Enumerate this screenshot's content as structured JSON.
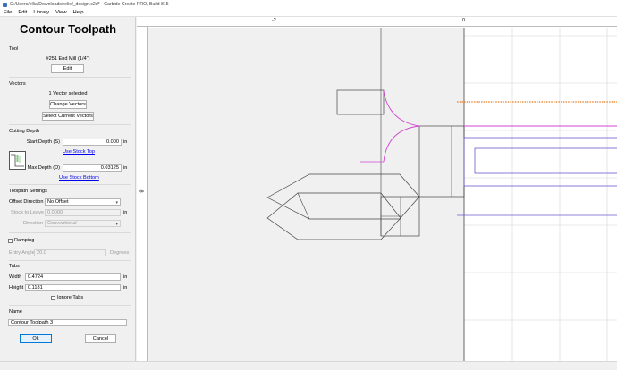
{
  "window": {
    "title": "C:/Users/ellia/Downloads/relief_design.c2d* - Carbide Create PRO, Build 815"
  },
  "menu": [
    "File",
    "Edit",
    "Library",
    "View",
    "Help"
  ],
  "panel": {
    "title": "Contour Toolpath",
    "tool": {
      "heading": "Tool",
      "name": "#251 End Mill (1/4\")",
      "edit_label": "Edit"
    },
    "vectors": {
      "heading": "Vectors",
      "status": "1 Vector selected",
      "change_label": "Change Vectors",
      "select_current_label": "Select Current Vectors"
    },
    "cutting_depth": {
      "heading": "Cutting Depth",
      "start_label": "Start Depth (S)",
      "start_value": "0.000",
      "start_unit": "in",
      "use_stock_top": "Use Stock Top",
      "max_label": "Max Depth (D)",
      "max_value": "0.03125",
      "max_unit": "in",
      "use_stock_bottom": "Use Stock Bottom"
    },
    "settings": {
      "heading": "Toolpath Settings",
      "offset_label": "Offset Direction",
      "offset_value": "No Offset",
      "stock_label": "Stock to Leave",
      "stock_value": "0.0000",
      "stock_unit": "in",
      "direction_label": "Direction",
      "direction_value": "Conventional"
    },
    "ramping": {
      "label": "Ramping",
      "checked": false,
      "angle_label": "Entry Angle",
      "angle_value": "20.0",
      "angle_unit": "Degrees"
    },
    "tabs": {
      "heading": "Tabs",
      "width_label": "Width",
      "width_value": "0.4724",
      "width_unit": "in",
      "height_label": "Height",
      "height_value": "0.1181",
      "height_unit": "in",
      "ignore_label": "Ignore Tabs",
      "ignore_checked": false
    },
    "name": {
      "heading": "Name",
      "value": "Contour Toolpath 3"
    },
    "ok_label": "Ok",
    "cancel_label": "Cancel"
  },
  "rulers": {
    "top": [
      "-2",
      "0"
    ],
    "left": [
      "8"
    ]
  },
  "colors": {
    "toolpath_orange": "#e87a1e",
    "arc_magenta": "#d048d0",
    "stock_blue": "#6a5acd",
    "accent_red": "#e02020"
  }
}
